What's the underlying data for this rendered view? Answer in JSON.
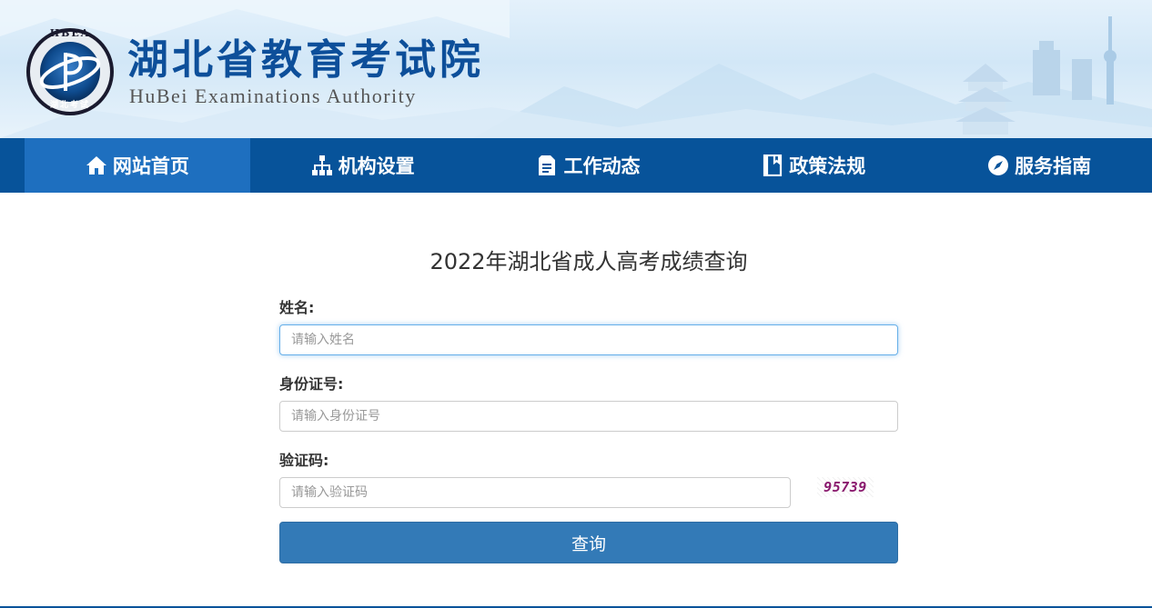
{
  "header": {
    "logo_badge": "HBEA",
    "logo_badge_bottom": "湖北考试",
    "title_cn": "湖北省教育考试院",
    "title_en": "HuBei Examinations Authority"
  },
  "nav": {
    "items": [
      {
        "label": "网站首页",
        "icon": "home-icon",
        "active": true
      },
      {
        "label": "机构设置",
        "icon": "org-chart-icon",
        "active": false
      },
      {
        "label": "工作动态",
        "icon": "document-icon",
        "active": false
      },
      {
        "label": "政策法规",
        "icon": "book-icon",
        "active": false
      },
      {
        "label": "服务指南",
        "icon": "compass-icon",
        "active": false
      }
    ]
  },
  "page": {
    "title": "2022年湖北省成人高考成绩查询"
  },
  "form": {
    "name_label": "姓名:",
    "name_placeholder": "请输入姓名",
    "id_label": "身份证号:",
    "id_placeholder": "请输入身份证号",
    "captcha_label": "验证码:",
    "captcha_placeholder": "请输入验证码",
    "captcha_text": "95739",
    "submit_label": "查询"
  },
  "colors": {
    "nav_bg": "#07539a",
    "nav_active": "#1e6fbf",
    "primary_button": "#337ab7",
    "logo_text": "#0d4f9a"
  }
}
